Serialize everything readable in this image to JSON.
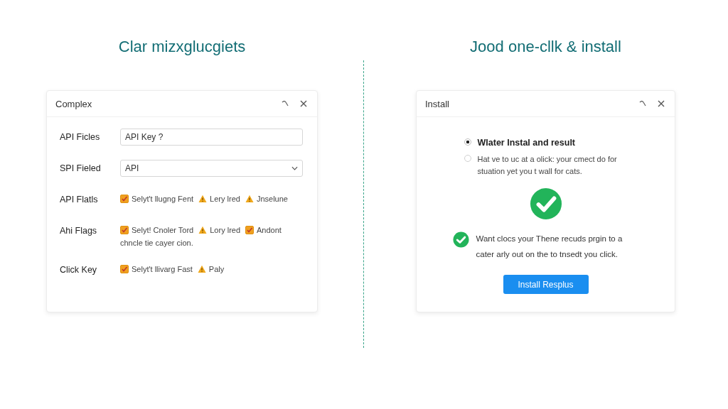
{
  "left": {
    "heading": "Clar mizxglucgiets",
    "dialog": {
      "title": "Complex",
      "fields": [
        {
          "kind": "text",
          "label": "API Ficles",
          "value": "API Key ?"
        },
        {
          "kind": "select",
          "label": "SPI Fieled",
          "value": "API"
        },
        {
          "kind": "flags",
          "label": "API Flatls",
          "flags": [
            {
              "kind": "check",
              "checked": true,
              "text": "Selyt't llugng Fent"
            },
            {
              "kind": "warning",
              "text": "Lery lred"
            },
            {
              "kind": "warning",
              "text": "Jnselune"
            }
          ]
        },
        {
          "kind": "flags",
          "label": "Ahi Flags",
          "flags": [
            {
              "kind": "check",
              "checked": true,
              "text": "Selyt! Cnoler Tord"
            },
            {
              "kind": "warning",
              "text": "Lory lred"
            },
            {
              "kind": "check",
              "checked": true,
              "text": "Andont"
            }
          ],
          "note": "chncle tie cayer cion."
        },
        {
          "kind": "flags",
          "label": "Click Key",
          "flags": [
            {
              "kind": "check",
              "checked": true,
              "text": "Selyt't llivarg Fast"
            },
            {
              "kind": "warning",
              "text": "Paly"
            }
          ]
        }
      ]
    }
  },
  "right": {
    "heading": "Jood one-cllk & install",
    "dialog": {
      "title": "Install",
      "options": [
        {
          "label": "Wlater Instal and result",
          "selected": true
        },
        {
          "label": "Hat ve to uc at a olick: your cmect do for stuation yet you t wall for cats.",
          "selected": false
        }
      ],
      "success_note": "Want clocs your Thene recuds prgin to a cater arly out on the to tnsedt you click.",
      "button": "Install Resplus"
    }
  }
}
